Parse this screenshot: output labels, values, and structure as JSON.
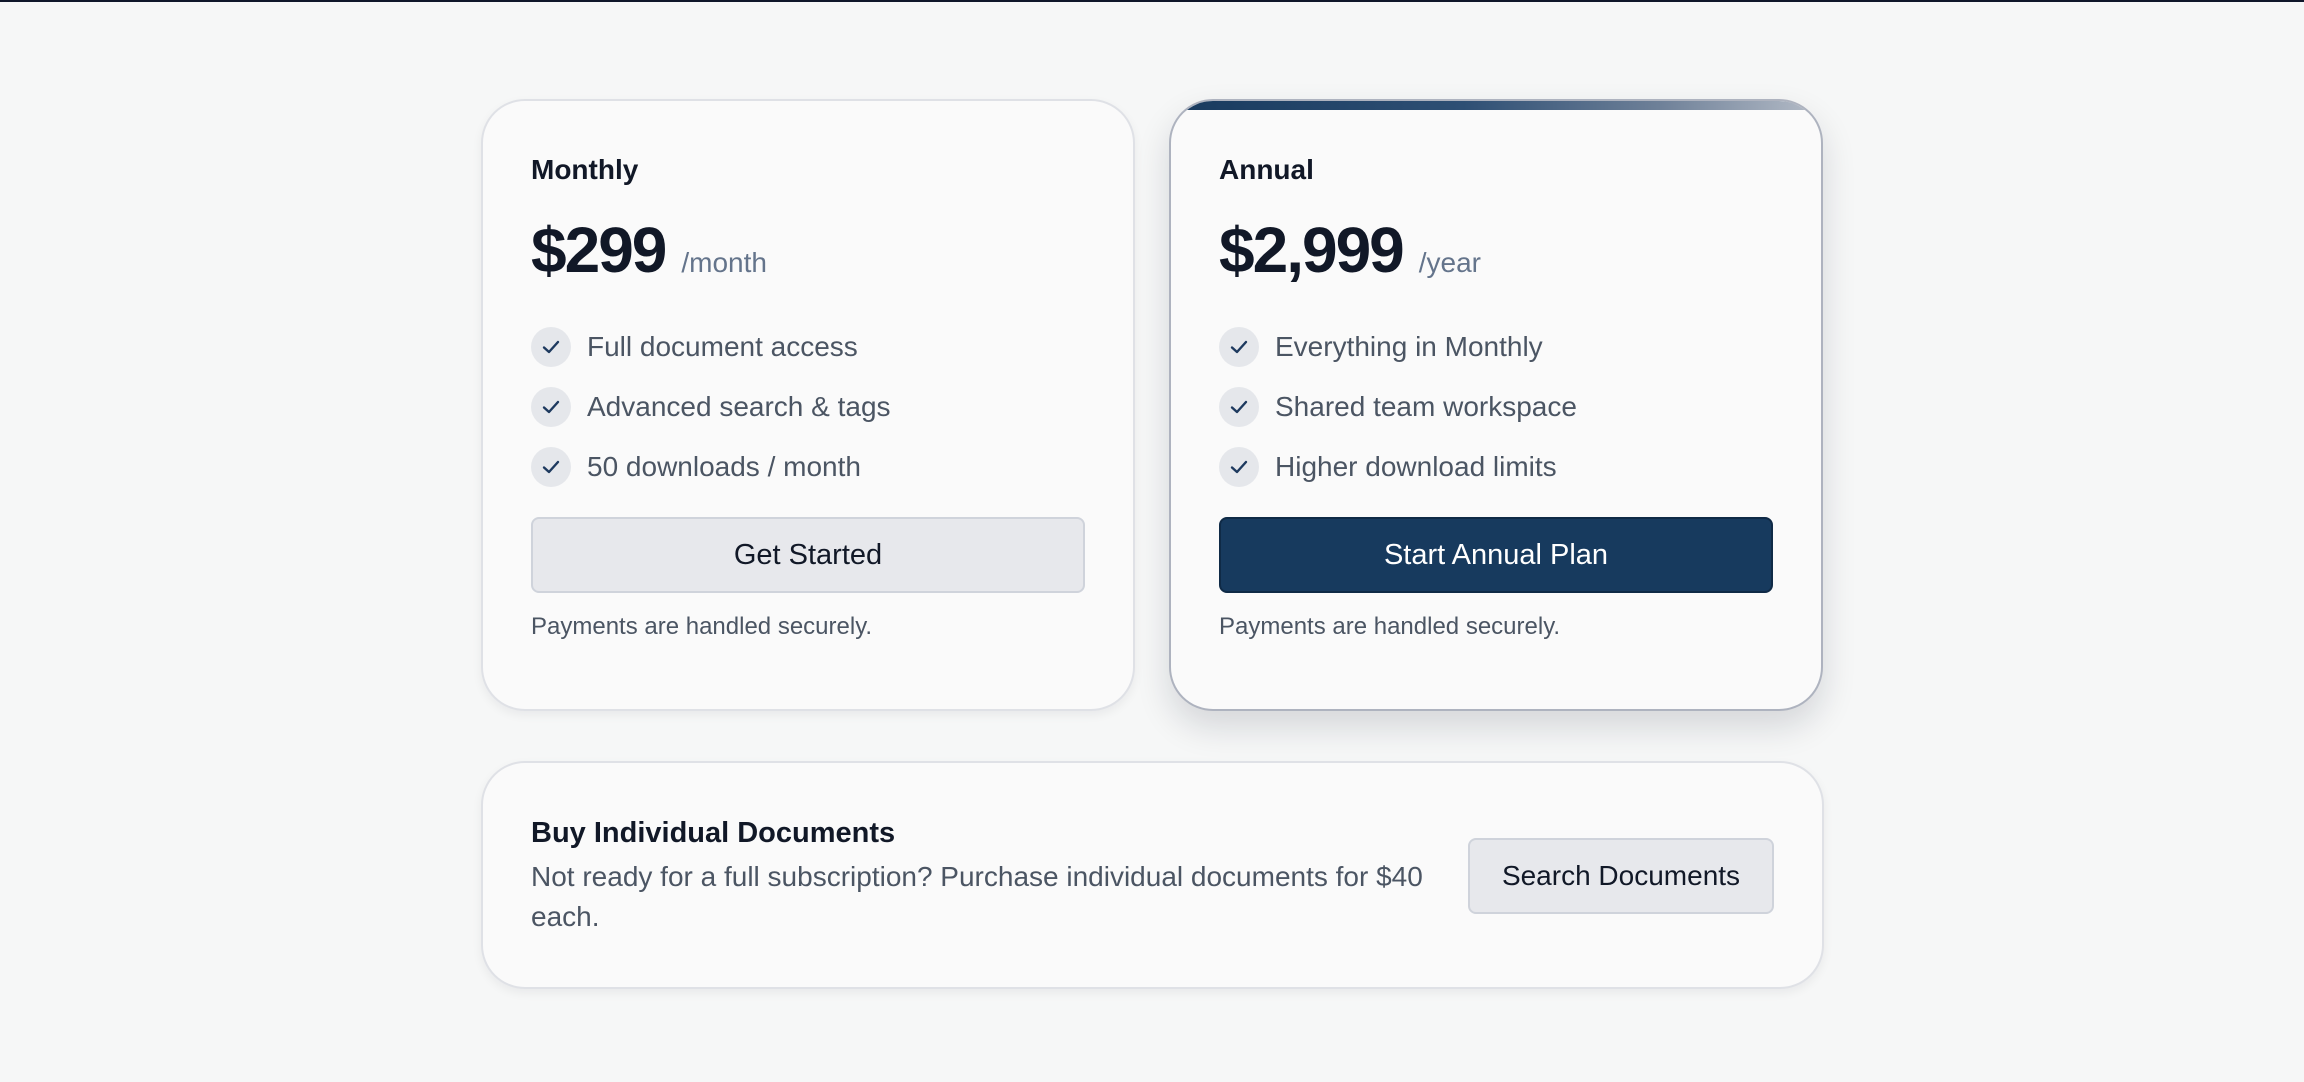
{
  "plans": [
    {
      "name": "Monthly",
      "price": "$299",
      "period": "/month",
      "features": [
        "Full document access",
        "Advanced search & tags",
        "50 downloads / month"
      ],
      "cta_label": "Get Started",
      "note": "Payments are handled securely."
    },
    {
      "name": "Annual",
      "price": "$2,999",
      "period": "/year",
      "features": [
        "Everything in Monthly",
        "Shared team workspace",
        "Higher download limits"
      ],
      "cta_label": "Start Annual Plan",
      "note": "Payments are handled securely."
    }
  ],
  "individual": {
    "title": "Buy Individual Documents",
    "description": "Not ready for a full subscription? Purchase individual documents for $40 each.",
    "button_label": "Search Documents"
  },
  "icons": {
    "feature_check": "check-icon"
  },
  "colors": {
    "primary": "#173a5e",
    "secondary_button": "#e7e8ec",
    "heading": "#111827",
    "body_text": "#4b5563",
    "check_bg": "#e5e7eb",
    "page_bg": "#f6f7f7"
  }
}
